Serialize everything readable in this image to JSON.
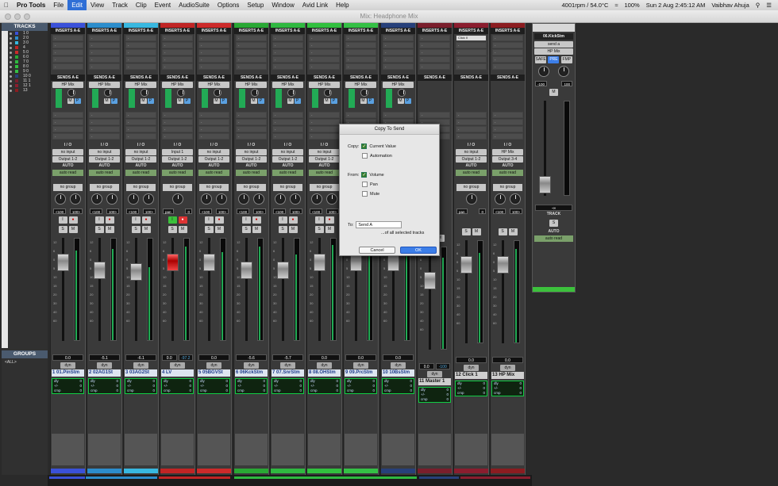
{
  "menubar": {
    "app": "Pro Tools",
    "items": [
      "File",
      "Edit",
      "View",
      "Track",
      "Clip",
      "Event",
      "AudioSuite",
      "Options",
      "Setup",
      "Window",
      "Avid Link",
      "Help"
    ],
    "active": "Edit",
    "status": [
      "4001rpm / 54.0°C",
      "100%",
      "Sun 2 Aug 2:45:12 AM",
      "Vaibhav Ahuja"
    ]
  },
  "window": {
    "title": "Mix: Headphone Mix"
  },
  "left": {
    "tracks_title": "TRACKS",
    "track_nums": [
      "1 0",
      "2 0",
      "3 0",
      "4",
      "5 0",
      "6 0",
      "7 0",
      "8 0",
      "9 0",
      "10 0",
      "11 1",
      "12 1",
      "13"
    ],
    "groups_title": "GROUPS",
    "groups_all": "<ALL>"
  },
  "strips": [
    {
      "num": "1",
      "name": "01.PinStm",
      "color": "#3a51d9",
      "input": "no input",
      "output": "Output 1-2",
      "auto": "auto read",
      "group": "no group",
      "vol": "0.0",
      "pan": [
        "<100",
        "100>"
      ],
      "send": "HP Mix"
    },
    {
      "num": "2",
      "name": "02AG1St",
      "color": "#2c8dcc",
      "input": "no input",
      "output": "Output 1-2",
      "auto": "auto read",
      "group": "no group",
      "vol": "-5.1",
      "pan": [
        "<100",
        "100>"
      ],
      "send": "HP Mix"
    },
    {
      "num": "3",
      "name": "03AG2St",
      "color": "#38b8e0",
      "input": "no input",
      "output": "Output 1-2",
      "auto": "auto read",
      "group": "no group",
      "vol": "-6.1",
      "pan": [
        "<100",
        "100>"
      ],
      "send": "HP Mix"
    },
    {
      "num": "4",
      "name": "LV",
      "color": "#c02424",
      "input": "Input 1",
      "output": "Output 1-2",
      "auto": "auto read",
      "group": "no group",
      "vol": "0.0",
      "vol2": "-97.2",
      "pan": [
        "pan",
        "0"
      ],
      "send": "HP Mix"
    },
    {
      "num": "5",
      "name": "05BGVSt",
      "color": "#cc2a2a",
      "input": "no input",
      "output": "Output 1-2",
      "auto": "auto read",
      "group": "no group",
      "vol": "0.0",
      "pan": [
        "<100",
        "100>"
      ],
      "send": "HP Mix"
    },
    {
      "num": "6",
      "name": "06KckStm",
      "color": "#29a834",
      "input": "no input",
      "output": "Output 1-2",
      "auto": "auto read",
      "group": "no group",
      "vol": "-5.6",
      "pan": [
        "<100",
        "100>"
      ],
      "send": "HP Mix"
    },
    {
      "num": "7",
      "name": "07.SnrStm",
      "color": "#2fb840",
      "input": "no input",
      "output": "Output 1-2",
      "auto": "auto read",
      "group": "no group",
      "vol": "-5.7",
      "pan": [
        "<100",
        "100>"
      ],
      "send": "HP Mix"
    },
    {
      "num": "8",
      "name": "08.OHStm",
      "color": "#31c03e",
      "input": "no input",
      "output": "Output 1-2",
      "auto": "auto read",
      "group": "no group",
      "vol": "0.0",
      "pan": [
        "<100",
        "100>"
      ],
      "send": "HP Mix"
    },
    {
      "num": "9",
      "name": "09.PrcStm",
      "color": "#34c045",
      "input": "no input",
      "output": "Output 1-2",
      "auto": "auto read",
      "group": "no group",
      "vol": "0.0",
      "pan": [
        "<100",
        "100>"
      ],
      "send": "HP Mix"
    },
    {
      "num": "10",
      "name": "10BsStm",
      "color": "#27407a",
      "input": "no input",
      "output": "Output 1-2",
      "auto": "auto read",
      "group": "no group",
      "vol": "0.0",
      "pan": [
        "<100",
        "100>"
      ],
      "send": "HP Mix"
    },
    {
      "num": "11",
      "name": "Master 1",
      "color": "#7a1e2c",
      "input": "",
      "output": "",
      "auto": "",
      "group": "",
      "vol": "0.0",
      "vol2": "-100",
      "pan": [
        "",
        ""
      ],
      "send": ""
    },
    {
      "num": "12",
      "name": "Click 1",
      "color": "#8a1d2e",
      "input": "no input",
      "output": "Output 1-2",
      "auto": "auto read",
      "group": "no group",
      "vol": "0.0",
      "pan": [
        "pan",
        "0"
      ],
      "send": "",
      "insert": "Click II"
    },
    {
      "num": "13",
      "name": "HP Mix",
      "color": "#8b1c20",
      "input": "HP Mix",
      "output": "Output 3-4",
      "auto": "auto read",
      "group": "no group",
      "vol": "0.0",
      "pan": [
        "<100",
        "100>"
      ],
      "send": ""
    }
  ],
  "labels": {
    "inserts": "INSERTS A-E",
    "sends": "SENDS A-E",
    "io": "I / O",
    "auto": "AUTO",
    "dyn": "dyn",
    "dly": "dly",
    "pm": "+/-",
    "cmp": "cmp",
    "zero": "0"
  },
  "fader_ticks": [
    "12",
    "6",
    "0",
    "5",
    "10",
    "15",
    "20",
    "30",
    "40",
    "60"
  ],
  "dialog": {
    "title": "Copy To Send",
    "copy_label": "Copy:",
    "current_value": "Current Value",
    "automation": "Automation",
    "from_label": "From:",
    "volume": "Volume",
    "pan": "Pan",
    "mute": "Mute",
    "to_label": "To:",
    "to_value": "Send A",
    "all_selected": "...of all selected tracks",
    "cancel": "Cancel",
    "ok": "OK"
  },
  "floating": {
    "title": "06.KickStm",
    "send": "send a",
    "target": "HP Mix",
    "safe": "SAFE",
    "pre": "PRE",
    "fmp": "FMP",
    "pan": [
      "-100",
      "100"
    ],
    "m": "M",
    "vol": "-∞",
    "track_lbl": "TRACK",
    "s": "S",
    "auto_lbl": "AUTO",
    "auto": "auto read"
  }
}
